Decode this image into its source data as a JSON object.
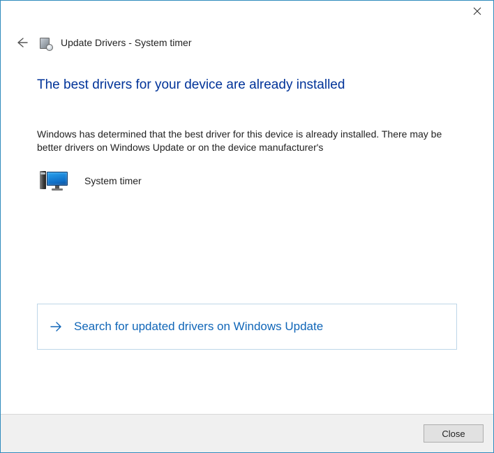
{
  "window": {
    "title": "Update Drivers - System timer"
  },
  "page": {
    "heading": "The best drivers for your device are already installed",
    "body": "Windows has determined that the best driver for this device is already installed. There may be better drivers on Windows Update or on the device manufacturer's"
  },
  "device": {
    "name": "System timer"
  },
  "actions": {
    "search_update": "Search for updated drivers on Windows Update"
  },
  "footer": {
    "close": "Close"
  }
}
